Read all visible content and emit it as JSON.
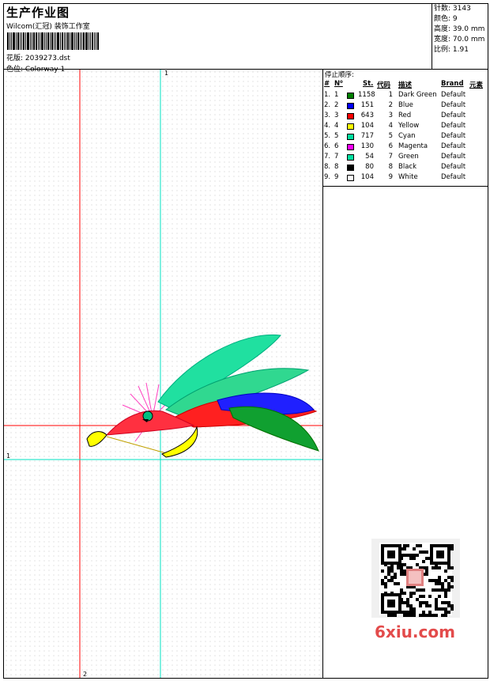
{
  "header": {
    "title": "生产作业图",
    "company": "Wilcom(汇冠) 装饰工作室",
    "design_label": "花版: 2039273.dst",
    "colorway_label": "色位: Colorway 1"
  },
  "info": [
    {
      "label": "针数:",
      "value": "3143"
    },
    {
      "label": "颜色:",
      "value": "9"
    },
    {
      "label": "高度:",
      "value": "39.0 mm"
    },
    {
      "label": "宽度:",
      "value": "70.0 mm"
    },
    {
      "label": "比例:",
      "value": "1.91"
    }
  ],
  "stop_sequence": {
    "title": "停止顺序:",
    "columns": {
      "num": "#",
      "n": "N⁰",
      "st": "St.",
      "code": "代码",
      "desc": "描述",
      "brand": "Brand",
      "element": "元素"
    },
    "rows": [
      {
        "num": "1.",
        "n": "1",
        "color": "#008000",
        "st": "1158",
        "code": "1",
        "desc": "Dark Green",
        "brand": "Default"
      },
      {
        "num": "2.",
        "n": "2",
        "color": "#0000ff",
        "st": "151",
        "code": "2",
        "desc": "Blue",
        "brand": "Default"
      },
      {
        "num": "3.",
        "n": "3",
        "color": "#ff0000",
        "st": "643",
        "code": "3",
        "desc": "Red",
        "brand": "Default"
      },
      {
        "num": "4.",
        "n": "4",
        "color": "#ffff00",
        "st": "104",
        "code": "4",
        "desc": "Yellow",
        "brand": "Default"
      },
      {
        "num": "5.",
        "n": "5",
        "color": "#00e0a0",
        "st": "717",
        "code": "5",
        "desc": "Cyan",
        "brand": "Default"
      },
      {
        "num": "6.",
        "n": "6",
        "color": "#ff00ff",
        "st": "130",
        "code": "6",
        "desc": "Magenta",
        "brand": "Default"
      },
      {
        "num": "7.",
        "n": "7",
        "color": "#00e0a0",
        "st": "54",
        "code": "7",
        "desc": "Green",
        "brand": "Default"
      },
      {
        "num": "8.",
        "n": "8",
        "color": "#000000",
        "st": "80",
        "code": "8",
        "desc": "Black",
        "brand": "Default"
      },
      {
        "num": "9.",
        "n": "9",
        "color": "#ffffff",
        "st": "104",
        "code": "9",
        "desc": "White",
        "brand": "Default"
      }
    ]
  },
  "crosshair": {
    "label_top": "1",
    "label_left": "1",
    "label_bottom": "2"
  },
  "watermark": {
    "site": "6xiu.com"
  },
  "colors": {
    "crosshair_red": "#ff0000",
    "crosshair_cyan": "#00e0c0"
  }
}
